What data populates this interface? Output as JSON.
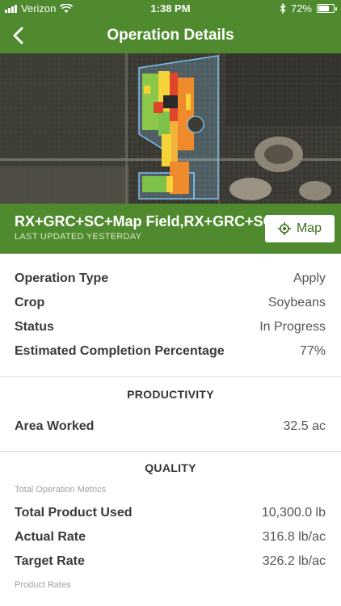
{
  "status_bar": {
    "carrier": "Verizon",
    "time": "1:38 PM",
    "battery_percent": "72%",
    "battery_level": 0.72,
    "icons": [
      "signal-icon",
      "wifi-icon",
      "bluetooth-icon",
      "battery-icon"
    ]
  },
  "nav": {
    "title": "Operation Details",
    "back_icon": "chevron-left-icon"
  },
  "field": {
    "name": "RX+GRC+SC+Map Field,RX+GRC+SC+",
    "last_updated": "LAST UPDATED YESTERDAY",
    "map_button_label": "Map",
    "map_button_icon": "location-target-icon"
  },
  "details": [
    {
      "label": "Operation Type",
      "value": "Apply"
    },
    {
      "label": "Crop",
      "value": "Soybeans"
    },
    {
      "label": "Status",
      "value": "In Progress"
    },
    {
      "label": "Estimated Completion Percentage",
      "value": "77%"
    }
  ],
  "productivity": {
    "title": "PRODUCTIVITY",
    "rows": [
      {
        "label": "Area Worked",
        "value": "32.5 ac"
      }
    ]
  },
  "quality": {
    "title": "QUALITY",
    "subhead_total": "Total Operation Metrics",
    "rows": [
      {
        "label": "Total Product Used",
        "value": "10,300.0 lb"
      },
      {
        "label": "Actual Rate",
        "value": "316.8 lb/ac"
      },
      {
        "label": "Target Rate",
        "value": "326.2 lb/ac"
      }
    ],
    "subhead_product": "Product Rates"
  },
  "colors": {
    "brand_green": "#4f8a2e",
    "button_text": "#3b6f22",
    "field_outline": "#7fc4f0"
  }
}
